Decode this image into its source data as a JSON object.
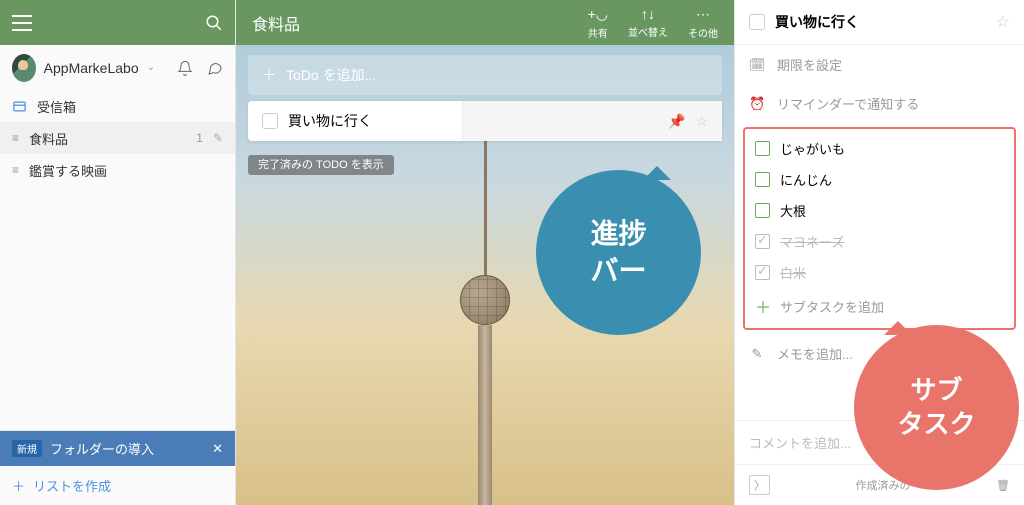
{
  "sidebar": {
    "username": "AppMarkeLabo",
    "nav": [
      {
        "icon": "inbox",
        "label": "受信箱",
        "count": "",
        "active": false
      },
      {
        "icon": "list",
        "label": "食料品",
        "count": "1",
        "active": true,
        "editable": true
      },
      {
        "icon": "list",
        "label": "鑑賞する映画",
        "count": "",
        "active": false
      }
    ],
    "folder_banner": {
      "badge": "新規",
      "text": "フォルダーの導入"
    },
    "create_list": "リストを作成"
  },
  "main": {
    "title": "食料品",
    "toolbar": [
      {
        "icon": "share",
        "label": "共有"
      },
      {
        "icon": "sort",
        "label": "並べ替え"
      },
      {
        "icon": "more",
        "label": "その他"
      }
    ],
    "add_placeholder": "ToDo を追加...",
    "todo": {
      "text": "買い物に行く"
    },
    "completed_label": "完了済みの TODO を表示",
    "callout_progress": "進捗\nバー",
    "callout_subtask": "サブ\nタスク"
  },
  "detail": {
    "title": "買い物に行く",
    "due": "期限を設定",
    "reminder": "リマインダーで通知する",
    "subtasks": [
      {
        "text": "じゃがいも",
        "done": false
      },
      {
        "text": "にんじん",
        "done": false
      },
      {
        "text": "大根",
        "done": false
      },
      {
        "text": "マヨネーズ",
        "done": true
      },
      {
        "text": "白米",
        "done": true
      }
    ],
    "add_subtask": "サブタスクを追加",
    "note": "メモを追加...",
    "comment": "コメントを追加...",
    "created": "作成済みの"
  }
}
